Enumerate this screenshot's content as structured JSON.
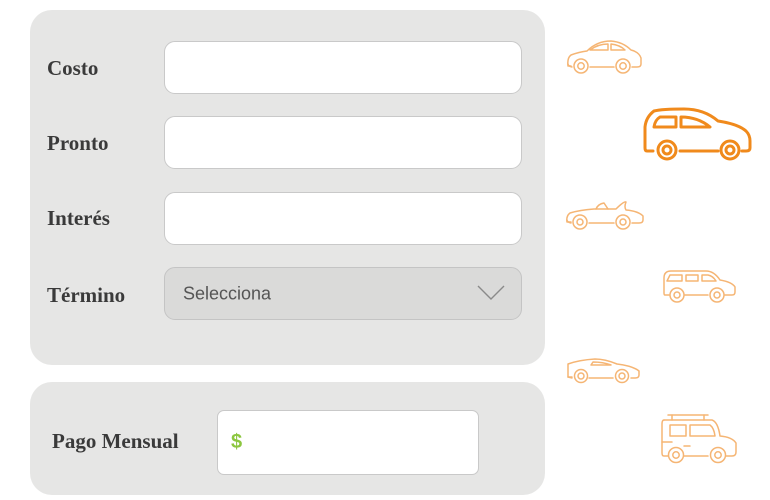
{
  "form": {
    "costo": {
      "label": "Costo",
      "value": "",
      "placeholder": ""
    },
    "pronto": {
      "label": "Pronto",
      "value": "",
      "placeholder": ""
    },
    "interes": {
      "label": "Interés",
      "value": "",
      "placeholder": ""
    },
    "termino": {
      "label": "Término",
      "selected": "Selecciona"
    }
  },
  "result": {
    "label": "Pago Mensual",
    "currency": "$",
    "value": ""
  },
  "vehicle_types": [
    {
      "name": "sedan-icon",
      "selected": false
    },
    {
      "name": "hatchback-icon",
      "selected": true
    },
    {
      "name": "convertible-icon",
      "selected": false
    },
    {
      "name": "wagon-icon",
      "selected": false
    },
    {
      "name": "sports-car-icon",
      "selected": false
    },
    {
      "name": "jeep-icon",
      "selected": false
    }
  ],
  "colors": {
    "panel": "#e6e6e5",
    "accent": "#f08a1c",
    "accent_light": "#f5b574",
    "currency": "#8cc63f"
  }
}
